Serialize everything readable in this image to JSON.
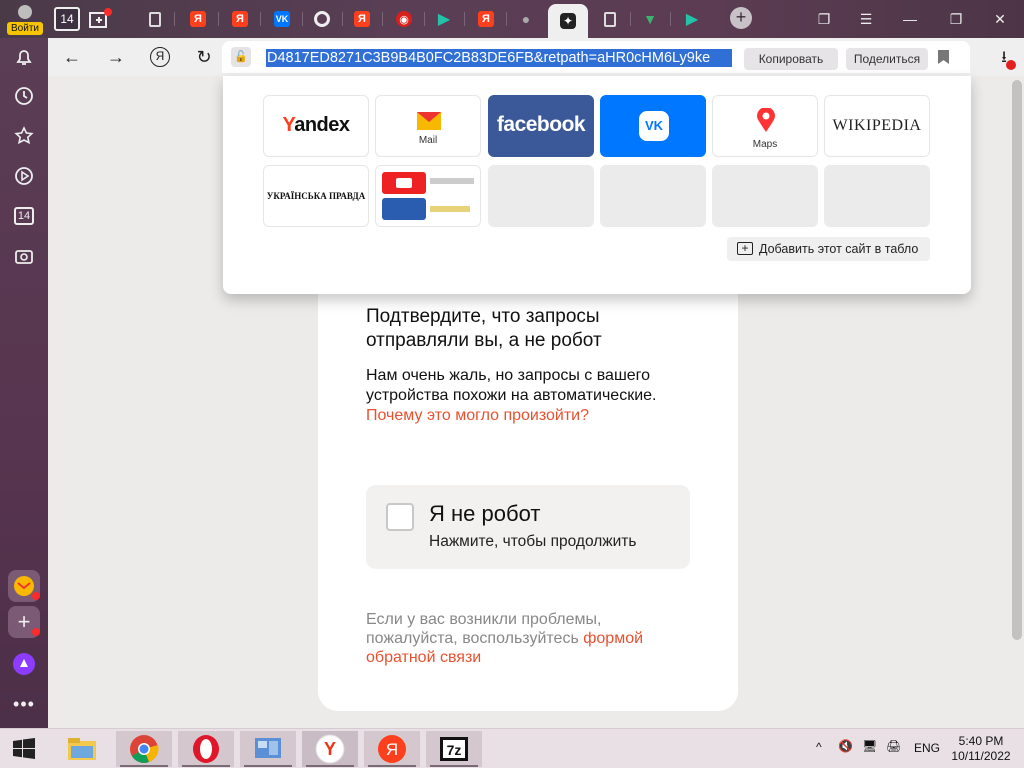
{
  "profile": {
    "login_label": "Войти"
  },
  "tabbar": {
    "tabs_count_badge": "14",
    "tabs": [
      {
        "icon": "document-icon"
      },
      {
        "icon": "yandex-icon"
      },
      {
        "icon": "yandex-icon"
      },
      {
        "icon": "vk-icon"
      },
      {
        "icon": "github-icon"
      },
      {
        "icon": "yandex-icon"
      },
      {
        "icon": "red-circle-icon"
      },
      {
        "icon": "play-icon"
      },
      {
        "icon": "yandex-icon"
      },
      {
        "icon": "pot-icon"
      },
      {
        "icon": "sparkle-icon",
        "active": true
      },
      {
        "icon": "document-icon"
      },
      {
        "icon": "vue-icon"
      },
      {
        "icon": "play-icon"
      }
    ]
  },
  "sidebar": {
    "tabs_badge": "14"
  },
  "toolbar": {
    "url_selected": "D4817ED8271C3B9B4B0FC2B83DE6FB&retpath=aHR0cHM6Ly9ke",
    "copy_label": "Копировать",
    "share_label": "Поделиться"
  },
  "tablo": {
    "tiles": [
      {
        "name": "Yandex"
      },
      {
        "name": "Mail",
        "caption": "Mail"
      },
      {
        "name": "facebook"
      },
      {
        "name": "VK"
      },
      {
        "name": "Maps",
        "caption": "Maps"
      },
      {
        "name": "Wikipedia",
        "display": "WIKIPEDIA"
      },
      {
        "name": "Українська правда",
        "display": "УКРАЇНСЬКА ПРАВДА"
      },
      {
        "name": "group"
      }
    ],
    "add_label": "Добавить этот сайт в табло"
  },
  "captcha": {
    "title": "Подтвердите, что запросы отправляли вы, а не робот",
    "text": "Нам очень жаль, но запросы с вашего устройства похожи на автоматические.",
    "why_link": "Почему это могло произойти?",
    "checkbox_title": "Я не робот",
    "checkbox_sub": "Нажмите, чтобы продолжить",
    "footer_text": "Если у вас возникли проблемы, пожалуйста, воспользуйтесь",
    "footer_link": "формой обратной связи"
  },
  "taskbar": {
    "language": "ENG",
    "time": "5:40 PM",
    "date": "10/11/2022"
  },
  "colors": {
    "accent_red": "#fc3f1d",
    "link": "#e8512f",
    "selection": "#2f6fd6",
    "vk_blue": "#0077ff",
    "facebook_blue": "#3b5998"
  }
}
